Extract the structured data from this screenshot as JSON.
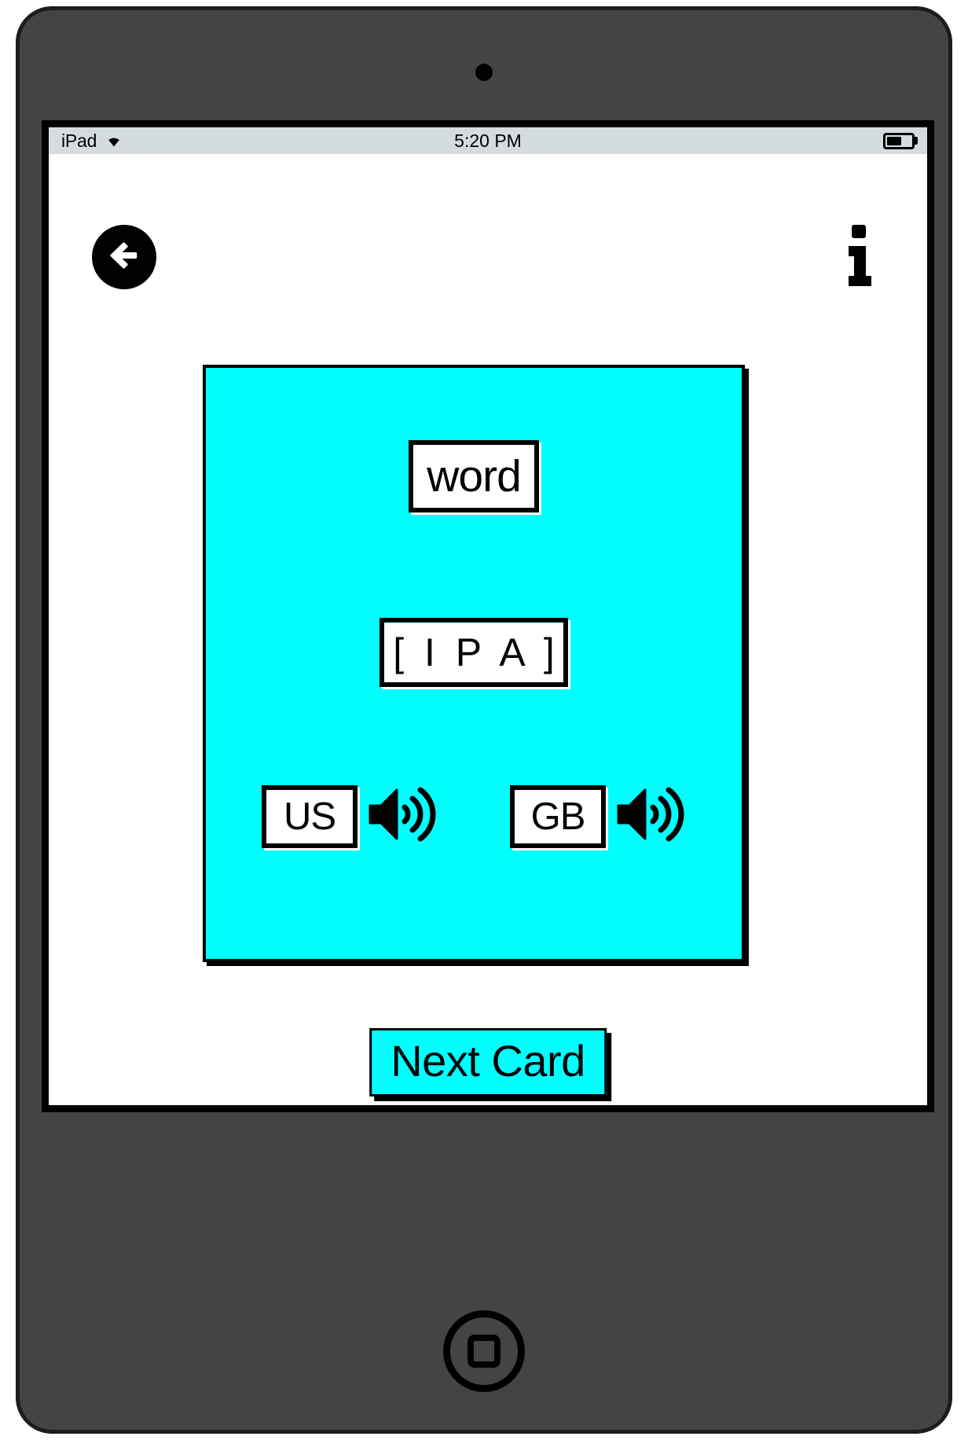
{
  "device": {
    "name": "ipad-tablet",
    "frame_color": "#444444",
    "bezel_color": "#000000"
  },
  "statusbar": {
    "device_label": "iPad",
    "wifi_icon": "wifi-icon",
    "time": "5:20 PM",
    "battery_icon": "battery-icon",
    "battery_level_percent": 60
  },
  "nav": {
    "back_icon": "arrow-left-icon",
    "back_label": "Back",
    "info_icon": "info-icon",
    "info_label": "Info"
  },
  "card": {
    "background_color": "#00ffff",
    "word": "word",
    "ipa": "[ I P A ]",
    "audio": [
      {
        "locale": "US",
        "icon": "speaker-icon",
        "name": "audio-us"
      },
      {
        "locale": "GB",
        "icon": "speaker-icon",
        "name": "audio-gb"
      }
    ]
  },
  "actions": {
    "next_card_label": "Next Card"
  },
  "home": {
    "icon": "home-button-icon"
  }
}
